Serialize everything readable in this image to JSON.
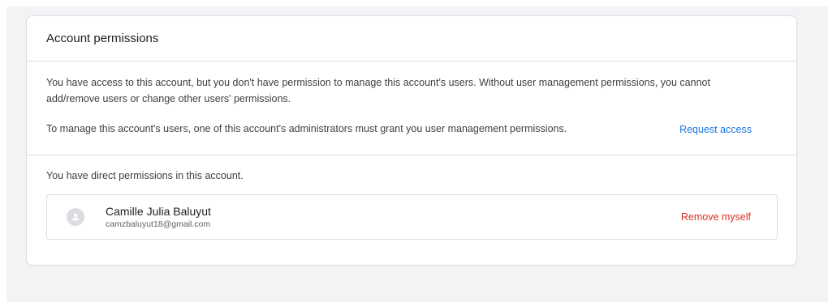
{
  "card": {
    "title": "Account permissions"
  },
  "notice": {
    "message": "You have access to this account, but you don't have permission to manage this account's users. Without user management permissions, you cannot add/remove users or change other users' permissions.",
    "manage_text": "To manage this account's users, one of this account's administrators must grant you user management permissions.",
    "request_label": "Request access"
  },
  "direct": {
    "message": "You have direct permissions in this account."
  },
  "user": {
    "name": "Camille Julia Baluyut",
    "email": "camzbaluyut18@gmail.com",
    "avatar_icon": "person-icon",
    "remove_label": "Remove myself"
  },
  "colors": {
    "link": "#1a73e8",
    "danger": "#d93025",
    "border": "#dadce0",
    "background": "#f1f3f4"
  }
}
